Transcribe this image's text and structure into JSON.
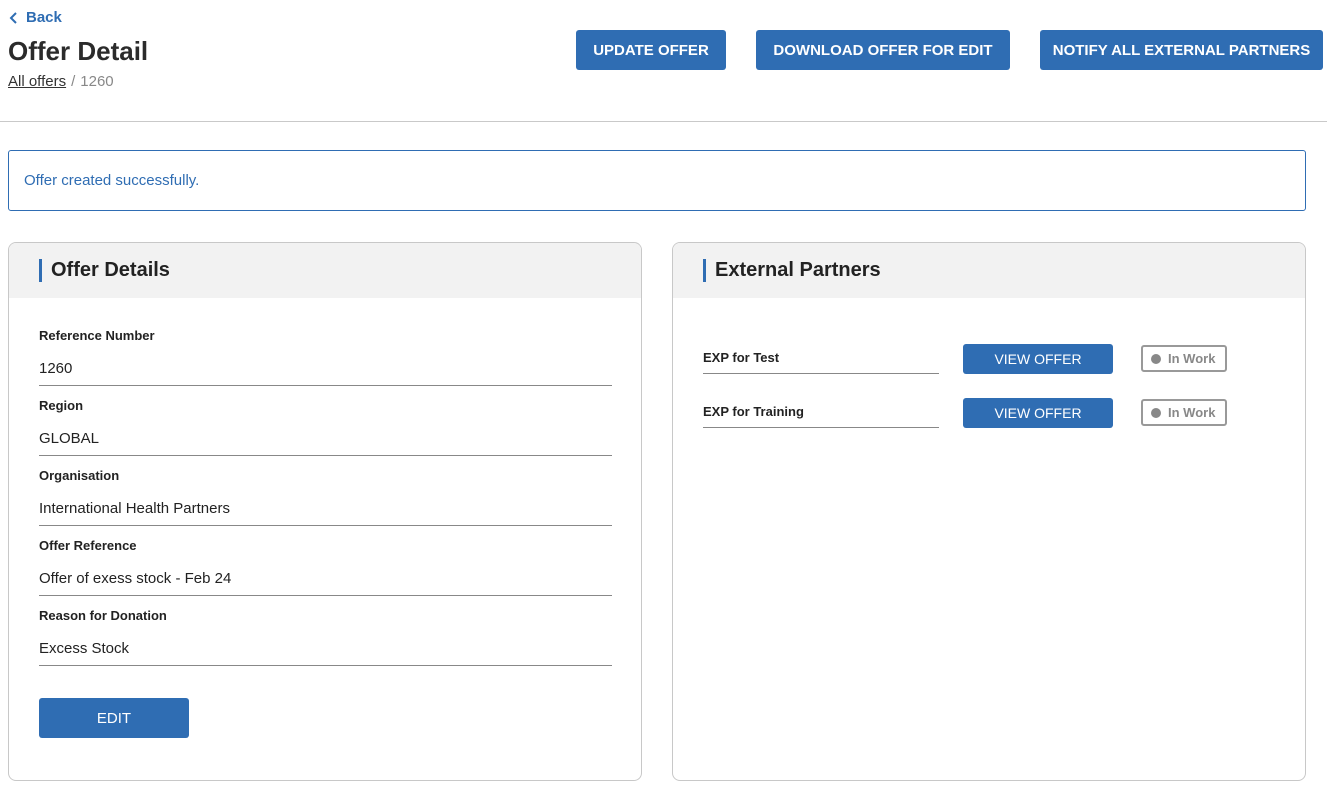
{
  "header": {
    "back_label": "Back",
    "title": "Offer Detail",
    "breadcrumb": {
      "link": "All offers",
      "separator": "/",
      "current": "1260"
    }
  },
  "actions": {
    "update_label": "UPDATE OFFER",
    "download_label": "DOWNLOAD OFFER FOR EDIT",
    "notify_label": "NOTIFY ALL EXTERNAL PARTNERS"
  },
  "alert": {
    "message": "Offer created successfully."
  },
  "offer_details": {
    "title": "Offer Details",
    "fields": [
      {
        "label": "Reference Number",
        "value": "1260"
      },
      {
        "label": "Region",
        "value": "GLOBAL"
      },
      {
        "label": "Organisation",
        "value": "International Health Partners"
      },
      {
        "label": "Offer Reference",
        "value": "Offer of exess stock - Feb 24"
      },
      {
        "label": "Reason for Donation",
        "value": "Excess Stock"
      }
    ],
    "edit_label": "EDIT"
  },
  "external_partners": {
    "title": "External Partners",
    "items": [
      {
        "name": "EXP for Test",
        "button_label": "VIEW OFFER",
        "status": "In Work"
      },
      {
        "name": "EXP for Training",
        "button_label": "VIEW OFFER",
        "status": "In Work"
      }
    ]
  },
  "colors": {
    "primary": "#2f6db3",
    "header_bg": "#f2f2f2",
    "status_gray": "#888888"
  }
}
